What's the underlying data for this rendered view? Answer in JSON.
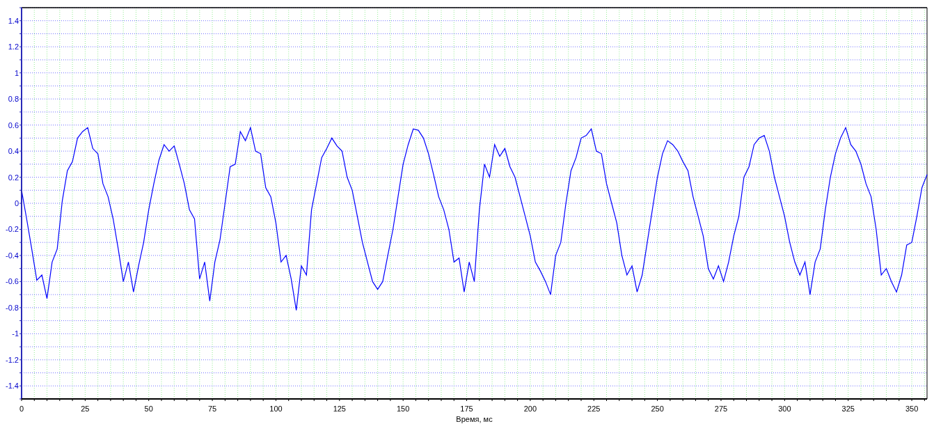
{
  "chart": {
    "chart_data": {
      "type": "line",
      "grid": true,
      "xlabel": "Время, мс",
      "xlim": [
        0,
        356
      ],
      "ylim": [
        -1.5,
        1.5
      ],
      "xticks": [
        0,
        25,
        50,
        75,
        100,
        125,
        150,
        175,
        200,
        225,
        250,
        275,
        300,
        325,
        350
      ],
      "yticks": [
        {
          "value": -1.4,
          "label": "-1.4"
        },
        {
          "value": -1.2,
          "label": "-1.2"
        },
        {
          "value": -1,
          "label": "-1"
        },
        {
          "value": -0.8,
          "label": "-0.8"
        },
        {
          "value": -0.6,
          "label": "-0.6"
        },
        {
          "value": -0.4,
          "label": "-0.4"
        },
        {
          "value": -0.2,
          "label": "-0.2"
        },
        {
          "value": 0,
          "label": "0"
        },
        {
          "value": 0.2,
          "label": "0.2"
        },
        {
          "value": 0.4,
          "label": "0.4"
        },
        {
          "value": 0.6,
          "label": "0.6"
        },
        {
          "value": 0.8,
          "label": "0.8"
        },
        {
          "value": 1,
          "label": "1"
        },
        {
          "value": 1.2,
          "label": "1.2"
        },
        {
          "value": 1.4,
          "label": "1.4"
        }
      ],
      "x": [
        0,
        2,
        4,
        6,
        8,
        10,
        12,
        14,
        16,
        18,
        20,
        22,
        24,
        26,
        28,
        30,
        32,
        34,
        36,
        38,
        40,
        42,
        44,
        46,
        48,
        50,
        52,
        54,
        56,
        58,
        60,
        62,
        64,
        66,
        68,
        70,
        72,
        74,
        76,
        78,
        80,
        82,
        84,
        86,
        88,
        90,
        92,
        94,
        96,
        98,
        100,
        102,
        104,
        106,
        108,
        110,
        112,
        114,
        116,
        118,
        120,
        122,
        124,
        126,
        128,
        130,
        132,
        134,
        136,
        138,
        140,
        142,
        144,
        146,
        148,
        150,
        152,
        154,
        156,
        158,
        160,
        162,
        164,
        166,
        168,
        170,
        172,
        174,
        176,
        178,
        180,
        182,
        184,
        186,
        188,
        190,
        192,
        194,
        196,
        198,
        200,
        202,
        204,
        206,
        208,
        210,
        212,
        214,
        216,
        218,
        220,
        222,
        224,
        226,
        228,
        230,
        232,
        234,
        236,
        238,
        240,
        242,
        244,
        246,
        248,
        250,
        252,
        254,
        256,
        258,
        260,
        262,
        264,
        266,
        268,
        270,
        272,
        274,
        276,
        278,
        280,
        282,
        284,
        286,
        288,
        290,
        292,
        294,
        296,
        298,
        300,
        302,
        304,
        306,
        308,
        310,
        312,
        314,
        316,
        318,
        320,
        322,
        324,
        326,
        328,
        330,
        332,
        334,
        336,
        338,
        340,
        342,
        344,
        346,
        348,
        350,
        352,
        354,
        356
      ],
      "series": [
        {
          "color": "#0000ff",
          "values": [
            0.1,
            -0.12,
            -0.35,
            -0.59,
            -0.55,
            -0.73,
            -0.45,
            -0.35,
            0.02,
            0.25,
            0.32,
            0.5,
            0.55,
            0.58,
            0.42,
            0.38,
            0.15,
            0.05,
            -0.12,
            -0.35,
            -0.6,
            -0.45,
            -0.68,
            -0.48,
            -0.3,
            -0.05,
            0.15,
            0.33,
            0.45,
            0.4,
            0.44,
            0.3,
            0.15,
            -0.05,
            -0.12,
            -0.58,
            -0.45,
            -0.75,
            -0.45,
            -0.28,
            0.0,
            0.28,
            0.3,
            0.55,
            0.48,
            0.58,
            0.4,
            0.38,
            0.12,
            0.05,
            -0.15,
            -0.45,
            -0.4,
            -0.58,
            -0.82,
            -0.48,
            -0.55,
            -0.05,
            0.15,
            0.35,
            0.42,
            0.5,
            0.44,
            0.4,
            0.2,
            0.1,
            -0.1,
            -0.3,
            -0.45,
            -0.6,
            -0.66,
            -0.6,
            -0.4,
            -0.2,
            0.05,
            0.3,
            0.45,
            0.57,
            0.56,
            0.5,
            0.38,
            0.22,
            0.05,
            -0.05,
            -0.2,
            -0.45,
            -0.42,
            -0.68,
            -0.45,
            -0.6,
            -0.05,
            0.3,
            0.2,
            0.45,
            0.36,
            0.42,
            0.28,
            0.2,
            0.05,
            -0.1,
            -0.25,
            -0.45,
            -0.52,
            -0.6,
            -0.7,
            -0.4,
            -0.3,
            0.0,
            0.25,
            0.35,
            0.5,
            0.52,
            0.57,
            0.4,
            0.38,
            0.15,
            0.0,
            -0.15,
            -0.4,
            -0.55,
            -0.48,
            -0.68,
            -0.55,
            -0.3,
            -0.05,
            0.2,
            0.38,
            0.48,
            0.45,
            0.4,
            0.32,
            0.25,
            0.05,
            -0.1,
            -0.25,
            -0.5,
            -0.58,
            -0.48,
            -0.6,
            -0.45,
            -0.25,
            -0.1,
            0.2,
            0.28,
            0.45,
            0.5,
            0.52,
            0.4,
            0.2,
            0.05,
            -0.1,
            -0.3,
            -0.45,
            -0.55,
            -0.45,
            -0.7,
            -0.45,
            -0.35,
            -0.05,
            0.2,
            0.38,
            0.5,
            0.58,
            0.45,
            0.4,
            0.3,
            0.15,
            0.05,
            -0.2,
            -0.55,
            -0.5,
            -0.6,
            -0.68,
            -0.55,
            -0.32,
            -0.3,
            -0.1,
            0.12,
            0.22
          ]
        }
      ]
    }
  }
}
